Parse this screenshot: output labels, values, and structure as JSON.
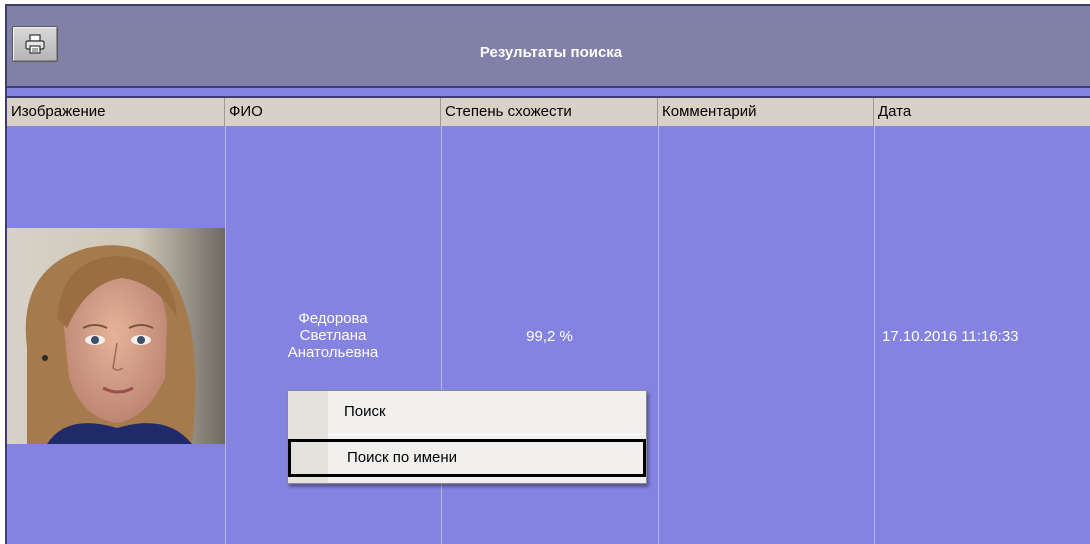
{
  "window": {
    "title": "Результаты поиска"
  },
  "toolbar": {
    "print_icon": "printer-icon"
  },
  "table": {
    "columns": [
      "Изображение",
      "ФИО",
      "Степень схожести",
      "Комментарий",
      "Дата"
    ],
    "rows": [
      {
        "fio_line1": "Федорова",
        "fio_line2": "Светлана",
        "fio_line3": "Анатольевна",
        "similarity": "99,2 %",
        "comment": "",
        "date": "17.10.2016 11:16:33"
      }
    ]
  },
  "context_menu": {
    "items": [
      {
        "label": "Поиск"
      },
      {
        "label": "Поиск по имени"
      }
    ],
    "selected_index": 1
  },
  "colors": {
    "row_bg": "#8583e2",
    "title_bg": "#8180a8",
    "header_bg": "#d7d1c7"
  }
}
